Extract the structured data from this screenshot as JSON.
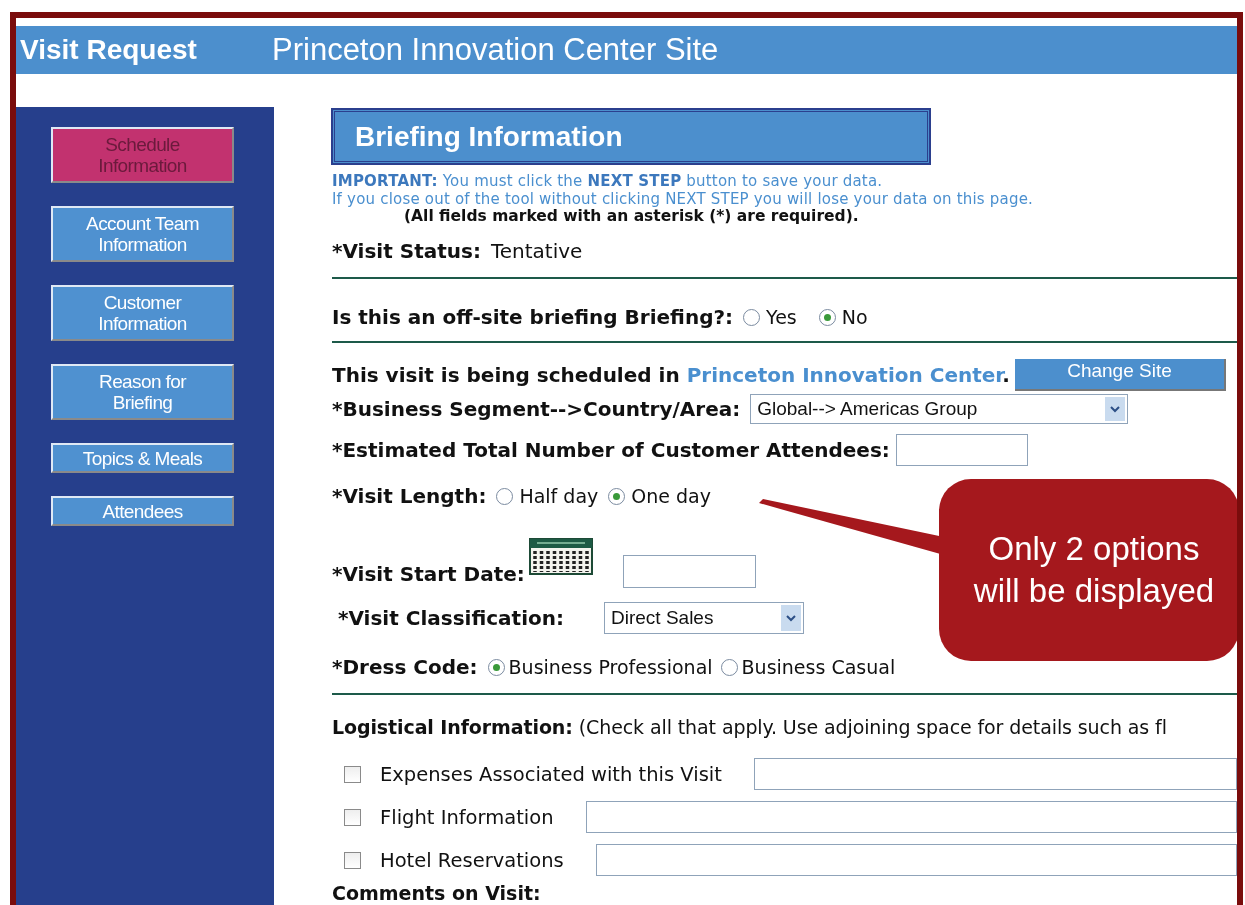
{
  "header": {
    "title": "Visit Request",
    "subtitle": "Princeton Innovation Center Site"
  },
  "sidebar": {
    "items": [
      {
        "label": "Schedule Information",
        "selected": true
      },
      {
        "label": "Account Team Information",
        "selected": false
      },
      {
        "label": "Customer Information",
        "selected": false
      },
      {
        "label": "Reason for Briefing",
        "selected": false
      },
      {
        "label": "Topics & Meals",
        "selected": false
      },
      {
        "label": "Attendees",
        "selected": false
      }
    ]
  },
  "section_title": "Briefing Information",
  "notices": [
    "**IMPORTANT:** You must click the **NEXT STEP** button to save your data.",
    "If you close out of the tool without clicking NEXT STEP you will lose your data on this page."
  ],
  "required_note": "(All fields marked with an asterisk (*) are required).",
  "visit_status": {
    "label": "*Visit Status:",
    "value": "Tentative"
  },
  "off_site": {
    "label": "Is this an off-site briefing Briefing?:",
    "options": [
      {
        "label": "Yes",
        "selected": false
      },
      {
        "label": "No",
        "selected": true
      }
    ]
  },
  "site_line": {
    "text": "This visit is being scheduled in",
    "site": "Princeton Innovation Center",
    "end": ".",
    "button": "Change Site"
  },
  "fields": [
    {
      "kind": "select",
      "label": "*Business Segment-->Country/Area:",
      "value": "Global--> Americas Group"
    },
    {
      "kind": "text",
      "label": "*Estimated Total Number of Customer Attendees:"
    },
    {
      "kind": "radio",
      "label": "*Visit Length:",
      "options": [
        {
          "label": "Half day",
          "selected": false
        },
        {
          "label": "One day",
          "selected": true
        }
      ]
    },
    {
      "kind": "date",
      "label": "*Visit Start Date:"
    },
    {
      "kind": "select",
      "label": "*Visit Classification:",
      "value": "Direct Sales"
    },
    {
      "kind": "radio",
      "label": "*Dress Code:",
      "options": [
        {
          "label": "Business Professional",
          "selected": true
        },
        {
          "label": "Business Casual",
          "selected": false
        }
      ]
    }
  ],
  "logistics": {
    "label": "Logistical Information:",
    "note": "(Check all that apply. Use adjoining space for details such as fl",
    "items": [
      {
        "label": "Expenses Associated with this Visit",
        "checked": false
      },
      {
        "label": "Flight Information",
        "checked": false
      },
      {
        "label": "Hotel Reservations",
        "checked": false
      }
    ]
  },
  "comments_label": "Comments on Visit:",
  "callout": {
    "lines": [
      "Only 2 options",
      "will be displayed"
    ]
  }
}
